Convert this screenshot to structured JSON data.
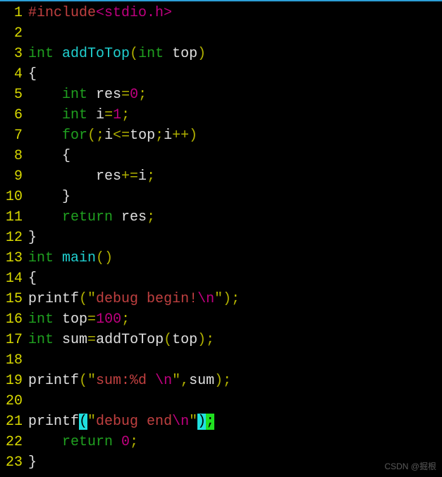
{
  "line_numbers": [
    "1",
    "2",
    "3",
    "4",
    "5",
    "6",
    "7",
    "8",
    "9",
    "10",
    "11",
    "12",
    "13",
    "14",
    "15",
    "16",
    "17",
    "18",
    "19",
    "20",
    "21",
    "22",
    "23"
  ],
  "code": {
    "l1": {
      "include": "#include",
      "header": "<stdio.h>"
    },
    "l3": {
      "type": "int",
      "func": "addToTop",
      "p1_type": "int",
      "p1_name": "top"
    },
    "l4": {
      "brace": "{"
    },
    "l5": {
      "type": "int",
      "name": "res",
      "eq": "=",
      "val": "0",
      "semi": ";"
    },
    "l6": {
      "type": "int",
      "name": "i",
      "eq": "=",
      "val": "1",
      "semi": ";"
    },
    "l7": {
      "for": "for",
      "lp": "(",
      "s1": ";",
      "v1": "i",
      "le": "<=",
      "v2": "top",
      "s2": ";",
      "v3": "i",
      "inc": "++",
      "rp": ")"
    },
    "l8": {
      "brace": "{"
    },
    "l9": {
      "v1": "res",
      "op": "+=",
      "v2": "i",
      "semi": ";"
    },
    "l10": {
      "brace": "}"
    },
    "l11": {
      "ret": "return",
      "v": "res",
      "semi": ";"
    },
    "l12": {
      "brace": "}"
    },
    "l13": {
      "type": "int",
      "func": "main",
      "lp": "(",
      "rp": ")"
    },
    "l14": {
      "brace": "{"
    },
    "l15": {
      "fn": "printf",
      "lp": "(",
      "q1": "\"",
      "str": "debug begin!",
      "esc": "\\n",
      "q2": "\"",
      "rp": ")",
      "semi": ";"
    },
    "l16": {
      "type": "int",
      "name": "top",
      "eq": "=",
      "val": "100",
      "semi": ";"
    },
    "l17": {
      "type": "int",
      "name": "sum",
      "eq": "=",
      "fn": "addToTop",
      "lp": "(",
      "arg": "top",
      "rp": ")",
      "semi": ";"
    },
    "l19": {
      "fn": "printf",
      "lp": "(",
      "q1": "\"",
      "str": "sum:%d ",
      "esc": "\\n",
      "q2": "\"",
      "c": ",",
      "arg": "sum",
      "rp": ")",
      "semi": ";"
    },
    "l21": {
      "fn": "printf",
      "lp": "(",
      "q1": "\"",
      "str": "debug end",
      "esc": "\\n",
      "q2": "\"",
      "rp": ")",
      "semi": ";"
    },
    "l22": {
      "ret": "return",
      "val": "0",
      "semi": ";"
    },
    "l23": {
      "brace": "}"
    }
  },
  "watermark": "CSDN @掘根",
  "colors": {
    "bg": "#000000",
    "gutter": "#d8d800",
    "keyword": "#20a020",
    "preproc": "#c04040",
    "number": "#c00080",
    "string": "#c04040",
    "func_def": "#20d0d0",
    "punct": "#b0b000",
    "highlight_paren": "#20e0e0",
    "highlight_close": "#20e020"
  }
}
